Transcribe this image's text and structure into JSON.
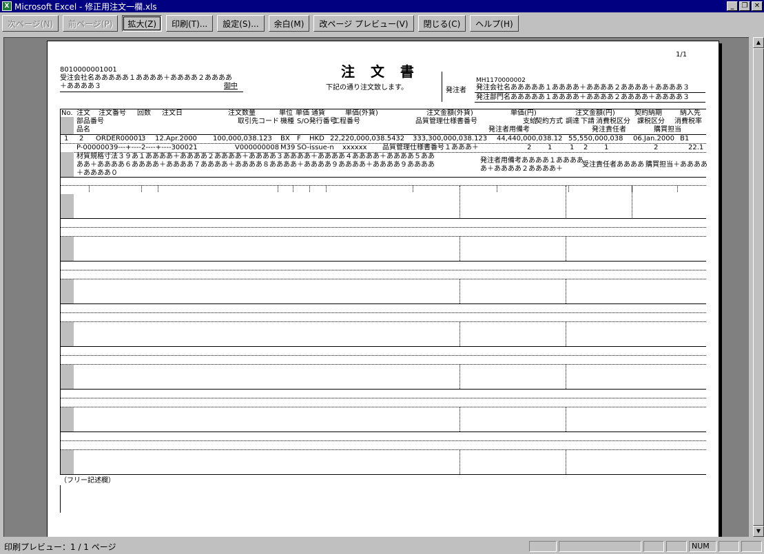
{
  "window": {
    "icon_label": "X",
    "title": "Microsoft Excel - 修正用注文一欄.xls",
    "minimize": "_",
    "restore": "❐",
    "close": "✕"
  },
  "toolbar": {
    "buttons": [
      "次ページ(N)",
      "前ページ(P)",
      "拡大(Z)",
      "印刷(T)...",
      "設定(S)...",
      "余白(M)",
      "改ページ プレビュー(V)",
      "閉じる(C)",
      "ヘルプ(H)"
    ]
  },
  "doc": {
    "page_number": "1/1",
    "code": "8010000001001",
    "customer_line1": "受注会社名あああああ１ああああ＋ああああ２ああああ",
    "customer_line2": "＋ああああ３",
    "honorific": "御中",
    "title": "注 文 書",
    "subtitle": "下記の通り注文致します。",
    "orderer_label": "発注者",
    "orderer_code": "MH1170000002",
    "orderer_company": "発注会社名あああああ１ああああ＋ああああ２ああああ＋ああああ３",
    "orderer_dept": "発注部門名あああああ１ああああ＋ああああ２ああああ＋ああああ３",
    "headers": {
      "row1": [
        "No.",
        "注文",
        "注文番号",
        "回数",
        "注文日",
        "注文数量",
        "単位",
        "単価",
        "通貨",
        "単価(外貨)",
        "注文金額(外貨)",
        "単価(円)",
        "注文金額(円)",
        "契約納期",
        "納入先"
      ],
      "row2": [
        "部品番号",
        "取引先コード",
        "機種",
        "S/O発行番号",
        "工程番号",
        "品質管理仕様書番号",
        "支給",
        "契約方式",
        "調達",
        "下請",
        "消費税区分",
        "課税区分",
        "消費税率"
      ],
      "row3": [
        "品名",
        "発注者用備考",
        "発注責任者",
        "購買担当"
      ]
    },
    "item": {
      "no": "1",
      "order_type": "2",
      "order_no": "ORDER00001",
      "times": "3",
      "order_date": "12.Apr.2000",
      "quantity": "100,000,038.123",
      "unit": "BX",
      "price_unit": "F",
      "currency": "HKD",
      "unit_price_fx": "22,220,000,038.5432",
      "amount_fx": "333,300,000,038.123",
      "unit_price_jpy": "44,440,000,038.12",
      "amount_jpy": "55,550,000,038",
      "delivery": "06.Jan.2000",
      "destination": "B1",
      "part_no": "P-00000039---+----2----+----300021",
      "supplier_code": "V000000008",
      "model": "M39",
      "so_no": "SO-issue-n",
      "process_no": "xxxxxx",
      "quality_spec": "品質管理仕様書番号１あああ＋",
      "supply": "2",
      "contract": "1",
      "procure": "1",
      "subcontract": "2",
      "tax_cat": "1",
      "taxable": "2",
      "tax_rate": "22.1",
      "name_line1": "材質規格寸法３９あ１ああああ＋ああああ２ああああ＋ああああ３ああああ＋ああああ４ああああ＋ああああ５ああ",
      "name_line2": "ああ＋ああああ６ああああ＋ああああ７ああああ＋ああああ８ああああ＋ああああ９ああああ＋ああああ９ああああ",
      "name_line3": "＋ああああ０",
      "remark_line1": "発注者用備考ああああ１ああああ",
      "remark_line2": "あ＋ああああ２ああああ＋",
      "responsible": "受注責任者ああああ",
      "buyer": "購買担当＋ああああ"
    },
    "free_text": "（フリー記述欄）"
  },
  "status": {
    "text": "印刷プレビュー：1 / 1 ページ",
    "num": "NUM"
  }
}
